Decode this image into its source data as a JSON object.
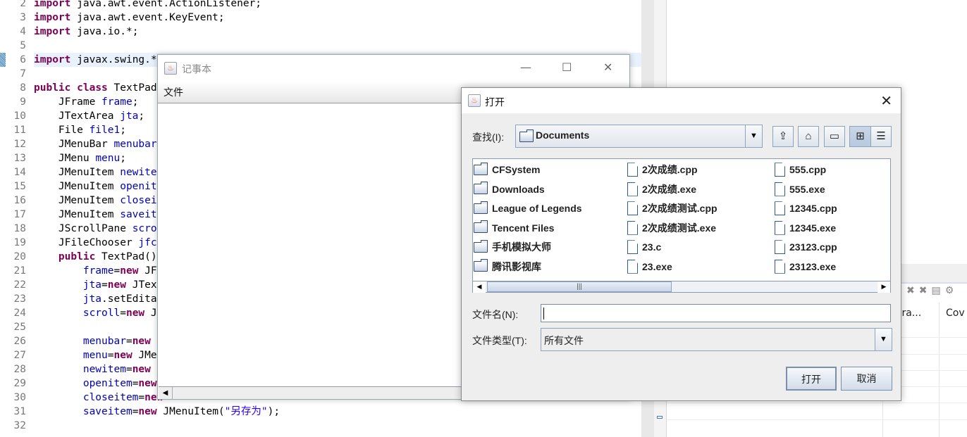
{
  "editor": {
    "lines": [
      {
        "n": "2",
        "segs": [
          [
            "import",
            "kw"
          ],
          [
            " java.awt.event.ActionListener;",
            ""
          ]
        ]
      },
      {
        "n": "3",
        "segs": [
          [
            "import",
            "kw"
          ],
          [
            " java.awt.event.KeyEvent;",
            ""
          ]
        ]
      },
      {
        "n": "4",
        "segs": [
          [
            "import",
            "kw"
          ],
          [
            " java.io.*;",
            ""
          ]
        ]
      },
      {
        "n": "5",
        "segs": []
      },
      {
        "n": "6",
        "segs": [
          [
            "import",
            "kw"
          ],
          [
            " javax.swing.*;",
            ""
          ]
        ],
        "highlight": true
      },
      {
        "n": "7",
        "segs": []
      },
      {
        "n": "8",
        "segs": [
          [
            "public",
            "kw"
          ],
          [
            " ",
            ""
          ],
          [
            "class",
            "kw"
          ],
          [
            " TextPad",
            ""
          ]
        ]
      },
      {
        "n": "9",
        "segs": [
          [
            "    JFrame ",
            ""
          ],
          [
            "frame",
            "fd"
          ],
          [
            ";",
            ""
          ]
        ]
      },
      {
        "n": "10",
        "segs": [
          [
            "    JTextArea ",
            ""
          ],
          [
            "jta",
            "fd"
          ],
          [
            ";",
            ""
          ]
        ]
      },
      {
        "n": "11",
        "segs": [
          [
            "    File ",
            ""
          ],
          [
            "file1",
            "fd"
          ],
          [
            ";",
            ""
          ]
        ]
      },
      {
        "n": "12",
        "segs": [
          [
            "    JMenuBar ",
            ""
          ],
          [
            "menubar",
            "fd"
          ]
        ]
      },
      {
        "n": "13",
        "segs": [
          [
            "    JMenu ",
            ""
          ],
          [
            "menu",
            "fd"
          ],
          [
            ";",
            ""
          ]
        ]
      },
      {
        "n": "14",
        "segs": [
          [
            "    JMenuItem ",
            ""
          ],
          [
            "newite",
            "fd"
          ]
        ]
      },
      {
        "n": "15",
        "segs": [
          [
            "    JMenuItem ",
            ""
          ],
          [
            "openit",
            "fd"
          ]
        ]
      },
      {
        "n": "16",
        "segs": [
          [
            "    JMenuItem ",
            ""
          ],
          [
            "closei",
            "fd"
          ]
        ]
      },
      {
        "n": "17",
        "segs": [
          [
            "    JMenuItem ",
            ""
          ],
          [
            "saveit",
            "fd"
          ]
        ]
      },
      {
        "n": "18",
        "segs": [
          [
            "    JScrollPane ",
            ""
          ],
          [
            "scro",
            "fd"
          ]
        ]
      },
      {
        "n": "19",
        "segs": [
          [
            "    JFileChooser ",
            ""
          ],
          [
            "jfc",
            "fd"
          ]
        ]
      },
      {
        "n": "20",
        "segs": [
          [
            "    ",
            ""
          ],
          [
            "public",
            "kw"
          ],
          [
            " TextPad()",
            ""
          ]
        ]
      },
      {
        "n": "21",
        "segs": [
          [
            "        ",
            ""
          ],
          [
            "frame",
            "fd"
          ],
          [
            "=",
            ""
          ],
          [
            "new",
            "kw"
          ],
          [
            " JF",
            ""
          ]
        ]
      },
      {
        "n": "22",
        "segs": [
          [
            "        ",
            ""
          ],
          [
            "jta",
            "fd"
          ],
          [
            "=",
            ""
          ],
          [
            "new",
            "kw"
          ],
          [
            " JTex",
            ""
          ]
        ]
      },
      {
        "n": "23",
        "segs": [
          [
            "        ",
            ""
          ],
          [
            "jta",
            "fd"
          ],
          [
            ".setEdita",
            ""
          ]
        ]
      },
      {
        "n": "24",
        "segs": [
          [
            "        ",
            ""
          ],
          [
            "scroll",
            "fd"
          ],
          [
            "=",
            ""
          ],
          [
            "new",
            "kw"
          ],
          [
            " J",
            ""
          ]
        ]
      },
      {
        "n": "25",
        "segs": []
      },
      {
        "n": "26",
        "segs": [
          [
            "        ",
            ""
          ],
          [
            "menubar",
            "fd"
          ],
          [
            "=",
            ""
          ],
          [
            "new",
            "kw"
          ]
        ]
      },
      {
        "n": "27",
        "segs": [
          [
            "        ",
            ""
          ],
          [
            "menu",
            "fd"
          ],
          [
            "=",
            ""
          ],
          [
            "new",
            "kw"
          ],
          [
            " JMe",
            ""
          ]
        ]
      },
      {
        "n": "28",
        "segs": [
          [
            "        ",
            ""
          ],
          [
            "newitem",
            "fd"
          ],
          [
            "=",
            ""
          ],
          [
            "new",
            "kw"
          ]
        ]
      },
      {
        "n": "29",
        "segs": [
          [
            "        ",
            ""
          ],
          [
            "openitem",
            "fd"
          ],
          [
            "=",
            ""
          ],
          [
            "new",
            "kw"
          ]
        ]
      },
      {
        "n": "30",
        "segs": [
          [
            "        ",
            ""
          ],
          [
            "closeitem",
            "fd"
          ],
          [
            "=",
            ""
          ],
          [
            "new",
            "kw"
          ]
        ]
      },
      {
        "n": "31",
        "segs": [
          [
            "        ",
            ""
          ],
          [
            "saveitem",
            "fd"
          ],
          [
            "=",
            ""
          ],
          [
            "new",
            "kw"
          ],
          [
            " JMenuItem(",
            ""
          ],
          [
            "\"另存为\"",
            "str"
          ],
          [
            ");",
            ""
          ]
        ]
      },
      {
        "n": "32",
        "segs": []
      }
    ]
  },
  "right_panel": {
    "col1": "overa...",
    "col2": "Cov",
    "toolbar_icons": [
      "remove-icon",
      "remove-all-icon",
      "collapse-icon",
      "settings-icon"
    ]
  },
  "notepad": {
    "title": "记事本",
    "menu": "文件",
    "controls": {
      "minimize": "—",
      "maximize": "☐",
      "close": "✕"
    }
  },
  "dialog": {
    "title": "打开",
    "look_in_label": "查找(I):",
    "look_in_value": "Documents",
    "toolbar": [
      "up-folder-icon",
      "home-icon",
      "new-folder-icon",
      "list-view-icon",
      "details-view-icon"
    ],
    "files": [
      {
        "name": "CFSystem",
        "type": "folder"
      },
      {
        "name": "Downloads",
        "type": "folder"
      },
      {
        "name": "League of Legends",
        "type": "folder"
      },
      {
        "name": "Tencent Files",
        "type": "folder"
      },
      {
        "name": "手机模拟大师",
        "type": "folder"
      },
      {
        "name": "腾讯影视库",
        "type": "folder"
      },
      {
        "name": "2次成绩.cpp",
        "type": "file"
      },
      {
        "name": "2次成绩.exe",
        "type": "file"
      },
      {
        "name": "2次成绩测试.cpp",
        "type": "file"
      },
      {
        "name": "2次成绩测试.exe",
        "type": "file"
      },
      {
        "name": "23.c",
        "type": "file"
      },
      {
        "name": "23.exe",
        "type": "file"
      },
      {
        "name": "555.cpp",
        "type": "file"
      },
      {
        "name": "555.exe",
        "type": "file"
      },
      {
        "name": "12345.cpp",
        "type": "file"
      },
      {
        "name": "12345.exe",
        "type": "file"
      },
      {
        "name": "23123.cpp",
        "type": "file"
      },
      {
        "name": "23123.exe",
        "type": "file"
      }
    ],
    "filename_label": "文件名(N):",
    "filename_value": "",
    "filetype_label": "文件类型(T):",
    "filetype_value": "所有文件",
    "open_button": "打开",
    "cancel_button": "取消"
  }
}
